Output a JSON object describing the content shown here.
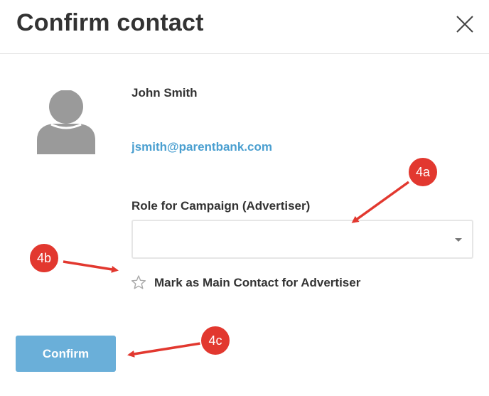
{
  "dialog": {
    "title": "Confirm contact"
  },
  "contact": {
    "name": "John Smith",
    "email": "jsmith@parentbank.com",
    "avatar_icon": "user-silhouette-icon"
  },
  "role": {
    "label": "Role for Campaign (Advertiser)",
    "selected_value": ""
  },
  "main_contact": {
    "label": "Mark as Main Contact for Advertiser",
    "star_icon": "star-outline-icon",
    "checked": false
  },
  "actions": {
    "confirm_label": "Confirm"
  },
  "annotations": [
    {
      "label": "4a"
    },
    {
      "label": "4b"
    },
    {
      "label": "4c"
    }
  ],
  "colors": {
    "accent": "#6aafd9",
    "link": "#4a9fd0",
    "annotation": "#e2382f"
  }
}
